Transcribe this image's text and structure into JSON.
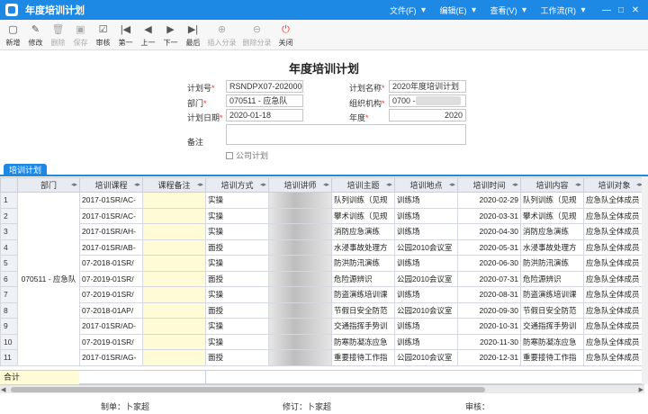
{
  "window": {
    "title": "年度培训计划",
    "menus": [
      "文件(F)",
      "编辑(E)",
      "查看(V)",
      "工作流(R)"
    ]
  },
  "toolbar": [
    {
      "label": "新增",
      "icon": "new-icon",
      "glyph": "▢",
      "enabled": true
    },
    {
      "label": "修改",
      "icon": "edit-icon",
      "glyph": "✎",
      "enabled": true
    },
    {
      "label": "删除",
      "icon": "delete-icon",
      "glyph": "🗑",
      "enabled": false
    },
    {
      "label": "保存",
      "icon": "save-icon",
      "glyph": "▣",
      "enabled": false
    },
    {
      "label": "审核",
      "icon": "approve-icon",
      "glyph": "☑",
      "enabled": true
    },
    {
      "label": "第一",
      "icon": "first-icon",
      "glyph": "|◀",
      "enabled": true
    },
    {
      "label": "上一",
      "icon": "previous-icon",
      "glyph": "◀",
      "enabled": true
    },
    {
      "label": "下一",
      "icon": "next-icon",
      "glyph": "▶",
      "enabled": true
    },
    {
      "label": "最后",
      "icon": "last-icon",
      "glyph": "▶|",
      "enabled": true
    },
    {
      "label": "插入分录",
      "icon": "insert-row-icon",
      "glyph": "⊕",
      "enabled": false
    },
    {
      "label": "删除分录",
      "icon": "delete-row-icon",
      "glyph": "⊖",
      "enabled": false
    },
    {
      "label": "关闭",
      "icon": "close-icon",
      "glyph": "⏻",
      "enabled": true
    }
  ],
  "form": {
    "heading": "年度培训计划",
    "plan_no_label": "计划号",
    "plan_no": "RSNDPX07-2020000",
    "plan_name_label": "计划名称",
    "plan_name": "2020年度培训计划",
    "dept_label": "部门",
    "dept": "070511 - 应急队",
    "org_label": "组织机构",
    "org": "0700 - 贵",
    "plan_date_label": "计划日期",
    "plan_date": "2020-01-18",
    "year_label": "年度",
    "year": "2020",
    "remark_label": "备注",
    "remark": "",
    "company_plan_label": "公司计划",
    "required_mark": "*"
  },
  "tab": {
    "label": "培训计划"
  },
  "grid": {
    "columns": [
      "",
      "部门",
      "培训课程",
      "课程备注",
      "培训方式",
      "培训讲师",
      "培训主题",
      "培训地点",
      "培训时间",
      "培训内容",
      "培训对象"
    ],
    "department": "070511 - 应急队",
    "rows": [
      {
        "no": "1",
        "course": "2017-01SR/AC-",
        "note": "",
        "method": "实操",
        "teacher": "",
        "topic": "队列训练（见规",
        "place": "训练场",
        "time": "2020-02-29",
        "content": "队列训练（见规",
        "audience": "应急队全体成员"
      },
      {
        "no": "2",
        "course": "2017-01SR/AC-",
        "note": "",
        "method": "实操",
        "teacher": "",
        "topic": "攀术训练（见规",
        "place": "训练场",
        "time": "2020-03-31",
        "content": "攀术训练（见规",
        "audience": "应急队全体成员"
      },
      {
        "no": "3",
        "course": "2017-01SR/AH-",
        "note": "",
        "method": "实操",
        "teacher": "",
        "topic": "消防应急演练",
        "place": "训练场",
        "time": "2020-04-30",
        "content": "消防应急演练",
        "audience": "应急队全体成员"
      },
      {
        "no": "4",
        "course": "2017-01SR/AB-",
        "note": "",
        "method": "面授",
        "teacher": "",
        "topic": "水浸事故处理方",
        "place": "公园2010会议室",
        "time": "2020-05-31",
        "content": "水浸事故处理方",
        "audience": "应急队全体成员"
      },
      {
        "no": "5",
        "course": "07-2018-01SR/",
        "note": "",
        "method": "实操",
        "teacher": "",
        "topic": "防洪防汛演练",
        "place": "训练场",
        "time": "2020-06-30",
        "content": "防洪防汛演练",
        "audience": "应急队全体成员"
      },
      {
        "no": "6",
        "course": "07-2019-01SR/",
        "note": "",
        "method": "面授",
        "teacher": "",
        "topic": "危险源辨识",
        "place": "公园2010会议室",
        "time": "2020-07-31",
        "content": "危险源辨识",
        "audience": "应急队全体成员"
      },
      {
        "no": "7",
        "course": "07-2019-01SR/",
        "note": "",
        "method": "实操",
        "teacher": "",
        "topic": "防盗演练培训课",
        "place": "训练场",
        "time": "2020-08-31",
        "content": "防盗演练培训课",
        "audience": "应急队全体成员"
      },
      {
        "no": "8",
        "course": "07-2018-01AP/",
        "note": "",
        "method": "面授",
        "teacher": "",
        "topic": "节假日安全防范",
        "place": "公园2010会议室",
        "time": "2020-09-30",
        "content": "节假日安全防范",
        "audience": "应急队全体成员"
      },
      {
        "no": "9",
        "course": "2017-01SR/AD-",
        "note": "",
        "method": "实操",
        "teacher": "",
        "topic": "交通指挥手势训",
        "place": "训练场",
        "time": "2020-10-31",
        "content": "交通指挥手势训",
        "audience": "应急队全体成员"
      },
      {
        "no": "10",
        "course": "07-2019-01SR/",
        "note": "",
        "method": "实操",
        "teacher": "",
        "topic": "防寒防凝冻应急",
        "place": "训练场",
        "time": "2020-11-30",
        "content": "防寒防凝冻应急",
        "audience": "应急队全体成员"
      },
      {
        "no": "11",
        "course": "2017-01SR/AG-",
        "note": "",
        "method": "面授",
        "teacher": "",
        "topic": "重要接待工作指",
        "place": "公园2010会议室",
        "time": "2020-12-31",
        "content": "重要接待工作指",
        "audience": "应急队全体成员"
      }
    ],
    "total_label": "合计"
  },
  "footer": {
    "maker": "制单：卜家超",
    "reviser": "修订：卜家超",
    "auditor": "审核："
  },
  "colors": {
    "accent": "#1e88e5",
    "required": "#e53935",
    "note_bg": "#fffbd6",
    "header_bg": "#e8ecf2"
  }
}
